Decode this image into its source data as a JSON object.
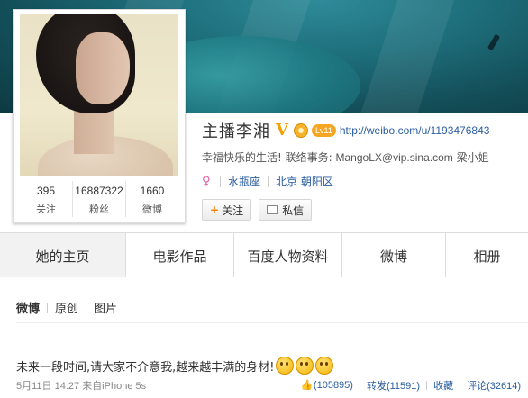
{
  "profile": {
    "name": "主播李湘",
    "verified_icon": "V",
    "level_badge": "Lv11",
    "url": "http://weibo.com/u/1193476843",
    "bio_prefix": "幸福快乐的生活!",
    "bio_contact_label": "联络事务:",
    "bio_email": "MangoLX@vip.sina.com",
    "bio_contact_name": "梁小姐",
    "zodiac": "水瓶座",
    "location": "北京 朝阳区",
    "stats": [
      {
        "num": "395",
        "label": "关注"
      },
      {
        "num": "16887322",
        "label": "粉丝"
      },
      {
        "num": "1660",
        "label": "微博"
      }
    ],
    "follow_label": "关注",
    "message_label": "私信"
  },
  "tabs": [
    "她的主页",
    "电影作品",
    "百度人物资料",
    "微博",
    "相册"
  ],
  "feed": {
    "subtabs": [
      "微博",
      "原创",
      "图片"
    ],
    "post_text": "未来一段时间,请大家不介意我,越来越丰满的身材!",
    "time": "5月11日 14:27",
    "source": "来自iPhone 5s",
    "likes": "(105895)",
    "repost": "转发(11591)",
    "favorite": "收藏",
    "comment": "评论(32614)"
  },
  "colors": {
    "link": "#2a5d9f",
    "banner": "#1e6f7c",
    "verified": "#f0a000"
  }
}
